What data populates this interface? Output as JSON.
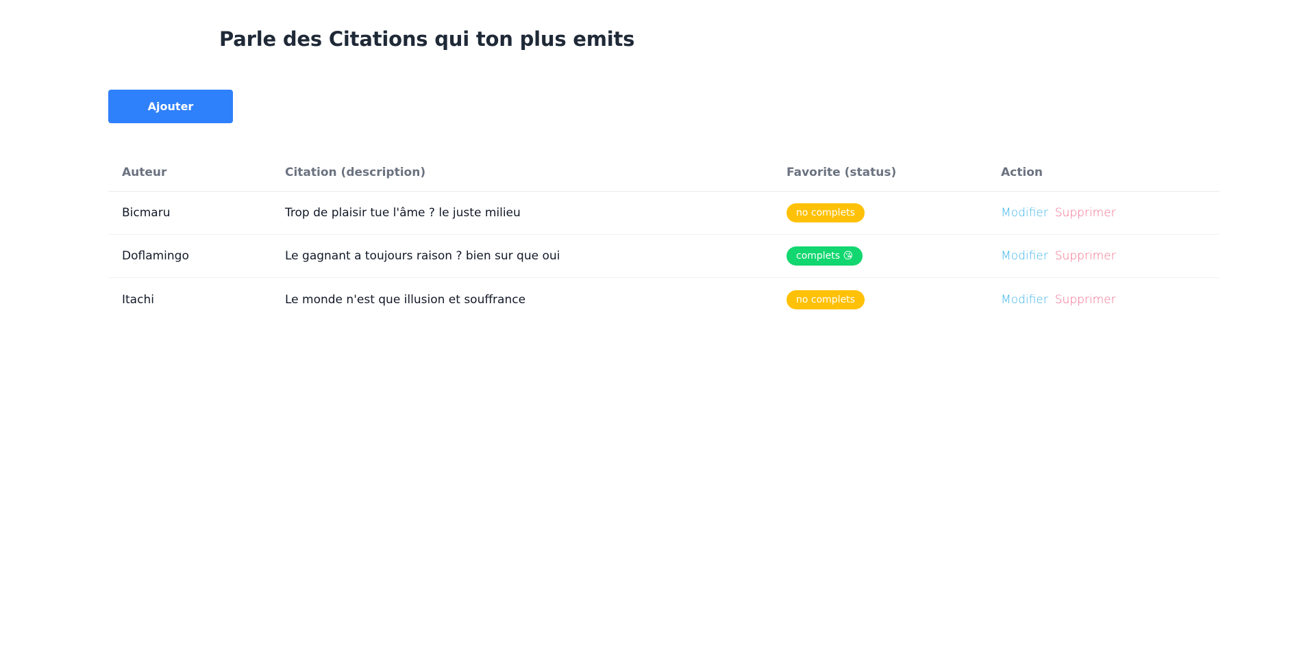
{
  "page": {
    "title": "Parle des Citations qui ton plus emits"
  },
  "toolbar": {
    "add_label": "Ajouter"
  },
  "table": {
    "headers": {
      "author": "Auteur",
      "citation": "Citation (description)",
      "status": "Favorite (status)",
      "action": "Action"
    },
    "rows": [
      {
        "author": "Bicmaru",
        "citation": "Trop de plaisir tue l'âme ? le juste milieu",
        "status": "no complets",
        "edit": "Modifier",
        "delete": "Supprimer"
      },
      {
        "author": "Doflamingo",
        "citation": "Le gagnant a toujours raison ? bien sur que oui",
        "status": "complets 😘",
        "edit": "Modifier",
        "delete": "Supprimer"
      },
      {
        "author": "Itachi",
        "citation": "Le monde n'est que illusion et souffrance",
        "status": "no complets",
        "edit": "Modifier",
        "delete": "Supprimer"
      }
    ]
  },
  "colors": {
    "primary": "#2f80fb",
    "badge_incomplete": "#ffc107",
    "badge_complete": "#12d66f",
    "link_edit": "#3bb3ea",
    "link_delete": "#f06b8a"
  }
}
